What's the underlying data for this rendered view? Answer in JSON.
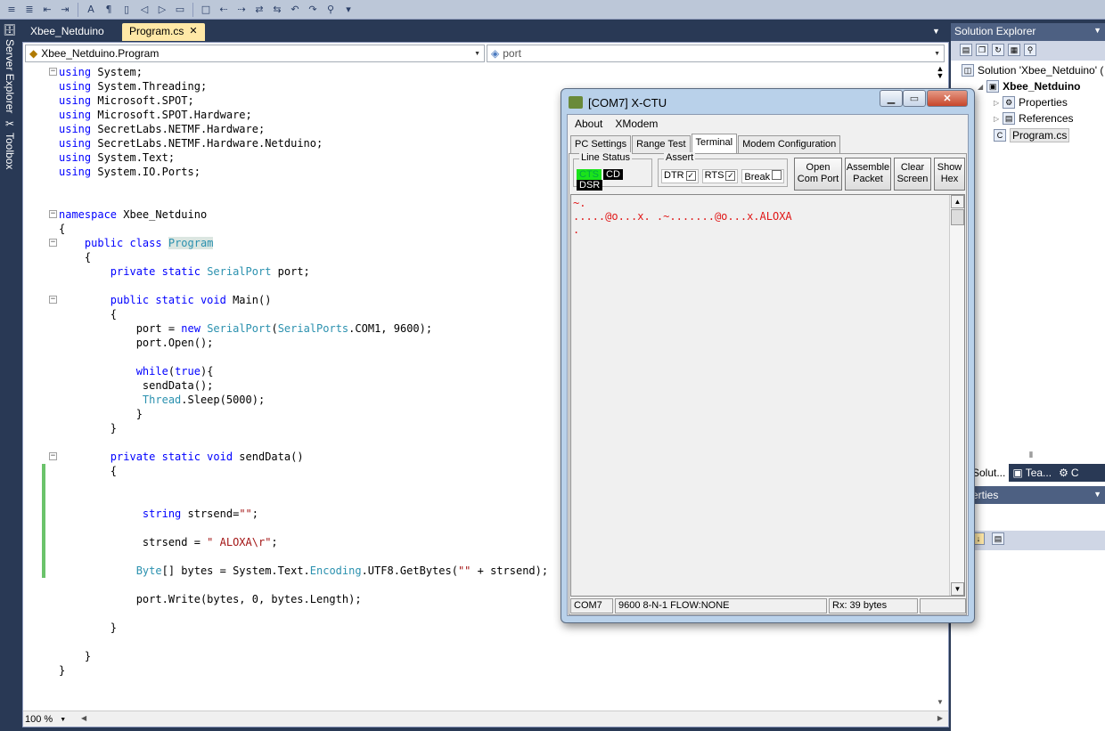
{
  "toolbar": {
    "icons": [
      "comment-icon",
      "uncomment-icon",
      "outdent-icon",
      "indent-icon",
      "font-icon",
      "format-icon",
      "bookmark-icon",
      "prev-bookmark-icon",
      "next-bookmark-icon",
      "clear-bookmark-icon",
      "window-icon",
      "back-icon",
      "forward-icon",
      "nav-icon",
      "nav2-icon",
      "undo-icon",
      "redo-icon",
      "find-icon",
      "overflow-icon"
    ]
  },
  "left_rail": {
    "server_explorer": "Server Explorer",
    "toolbox": "Toolbox"
  },
  "doc_tabs": [
    {
      "label": "Xbee_Netduino",
      "active": false
    },
    {
      "label": "Program.cs",
      "active": true
    }
  ],
  "editor": {
    "type_combo": "Xbee_Netduino.Program",
    "member_combo": "port",
    "zoom": "100 %",
    "lines": [
      [
        [
          "k",
          "using"
        ],
        [
          "p",
          " System;"
        ]
      ],
      [
        [
          "k",
          "using"
        ],
        [
          "p",
          " System.Threading;"
        ]
      ],
      [
        [
          "k",
          "using"
        ],
        [
          "p",
          " Microsoft.SPOT;"
        ]
      ],
      [
        [
          "k",
          "using"
        ],
        [
          "p",
          " Microsoft.SPOT.Hardware;"
        ]
      ],
      [
        [
          "k",
          "using"
        ],
        [
          "p",
          " SecretLabs.NETMF.Hardware;"
        ]
      ],
      [
        [
          "k",
          "using"
        ],
        [
          "p",
          " SecretLabs.NETMF.Hardware.Netduino;"
        ]
      ],
      [
        [
          "k",
          "using"
        ],
        [
          "p",
          " System.Text;"
        ]
      ],
      [
        [
          "k",
          "using"
        ],
        [
          "p",
          " System.IO.Ports;"
        ]
      ],
      [],
      [],
      [
        [
          "k",
          "namespace"
        ],
        [
          "p",
          " Xbee_Netduino"
        ]
      ],
      [
        [
          "p",
          "{"
        ]
      ],
      [
        [
          "p",
          "    "
        ],
        [
          "k",
          "public class"
        ],
        [
          "p",
          " "
        ],
        [
          "h",
          "Program"
        ]
      ],
      [
        [
          "p",
          "    {"
        ]
      ],
      [
        [
          "p",
          "        "
        ],
        [
          "k",
          "private static"
        ],
        [
          "p",
          " "
        ],
        [
          "t",
          "SerialPort"
        ],
        [
          "p",
          " port;"
        ]
      ],
      [],
      [
        [
          "p",
          "        "
        ],
        [
          "k",
          "public static void"
        ],
        [
          "p",
          " Main()"
        ]
      ],
      [
        [
          "p",
          "        {"
        ]
      ],
      [
        [
          "p",
          "            port = "
        ],
        [
          "k",
          "new"
        ],
        [
          "p",
          " "
        ],
        [
          "t",
          "SerialPort"
        ],
        [
          "p",
          "("
        ],
        [
          "t",
          "SerialPorts"
        ],
        [
          "p",
          ".COM1, 9600);"
        ]
      ],
      [
        [
          "p",
          "            port.Open();"
        ]
      ],
      [],
      [
        [
          "p",
          "            "
        ],
        [
          "k",
          "while"
        ],
        [
          "p",
          "("
        ],
        [
          "k",
          "true"
        ],
        [
          "p",
          "){"
        ]
      ],
      [
        [
          "p",
          "             sendData();"
        ]
      ],
      [
        [
          "p",
          "             "
        ],
        [
          "t",
          "Thread"
        ],
        [
          "p",
          ".Sleep(5000);"
        ]
      ],
      [
        [
          "p",
          "            }"
        ]
      ],
      [
        [
          "p",
          "        }"
        ]
      ],
      [],
      [
        [
          "p",
          "        "
        ],
        [
          "k",
          "private static void"
        ],
        [
          "p",
          " sendData()"
        ]
      ],
      [
        [
          "p",
          "        {"
        ]
      ],
      [],
      [],
      [
        [
          "p",
          "             "
        ],
        [
          "k",
          "string"
        ],
        [
          "p",
          " strsend="
        ],
        [
          "s",
          "\"\""
        ],
        [
          "p",
          ";"
        ]
      ],
      [],
      [
        [
          "p",
          "             strsend = "
        ],
        [
          "s",
          "\" ALOXA\\r\""
        ],
        [
          "p",
          ";"
        ]
      ],
      [],
      [
        [
          "p",
          "            "
        ],
        [
          "t",
          "Byte"
        ],
        [
          "p",
          "[] bytes = System.Text."
        ],
        [
          "t",
          "Encoding"
        ],
        [
          "p",
          ".UTF8.GetBytes("
        ],
        [
          "s",
          "\"\""
        ],
        [
          "p",
          " + strsend);"
        ]
      ],
      [],
      [
        [
          "p",
          "            port.Write(bytes, 0, bytes.Length);"
        ]
      ],
      [],
      [
        [
          "p",
          "        }"
        ]
      ],
      [],
      [
        [
          "p",
          "    }"
        ]
      ],
      [
        [
          "p",
          "}"
        ]
      ]
    ]
  },
  "solution_explorer": {
    "title": "Solution Explorer",
    "items": [
      {
        "label": "Solution 'Xbee_Netduino' (",
        "level": 0,
        "icon": "solution-icon",
        "bold": false
      },
      {
        "label": "Xbee_Netduino",
        "level": 1,
        "icon": "project-icon",
        "bold": true
      },
      {
        "label": "Properties",
        "level": 2,
        "icon": "properties-icon",
        "bold": false
      },
      {
        "label": "References",
        "level": 2,
        "icon": "references-icon",
        "bold": false
      },
      {
        "label": "Program.cs",
        "level": 2,
        "icon": "csharp-file-icon",
        "bold": false
      }
    ],
    "bottom_tabs": [
      "Solut...",
      "Tea...",
      "C"
    ],
    "properties_title": "erties"
  },
  "xctu": {
    "title": "[COM7] X-CTU",
    "menu": [
      "About",
      "XModem"
    ],
    "tabs": [
      {
        "label": "PC Settings",
        "active": false
      },
      {
        "label": "Range Test",
        "active": false
      },
      {
        "label": "Terminal",
        "active": true
      },
      {
        "label": "Modem Configuration",
        "active": false
      }
    ],
    "line_status": {
      "label": "Line Status",
      "leds": [
        {
          "label": "CTS",
          "on": true
        },
        {
          "label": "CD",
          "on": false
        },
        {
          "label": "DSR",
          "on": false
        }
      ]
    },
    "assert": {
      "label": "Assert",
      "items": [
        {
          "label": "DTR",
          "checked": true
        },
        {
          "label": "RTS",
          "checked": true
        },
        {
          "label": "Break",
          "checked": false
        }
      ]
    },
    "buttons": [
      {
        "line1": "Open",
        "line2": "Com Port"
      },
      {
        "line1": "Assemble",
        "line2": "Packet"
      },
      {
        "line1": "Clear",
        "line2": "Screen"
      },
      {
        "line1": "Show",
        "line2": "Hex"
      }
    ],
    "terminal_lines": [
      "~.",
      ".....@o...x. .~.......@o...x.ALOXA",
      "."
    ],
    "status": {
      "port": "COM7",
      "settings": "9600 8-N-1  FLOW:NONE",
      "rx": "Rx: 39 bytes"
    },
    "text_color": "#e01818"
  }
}
